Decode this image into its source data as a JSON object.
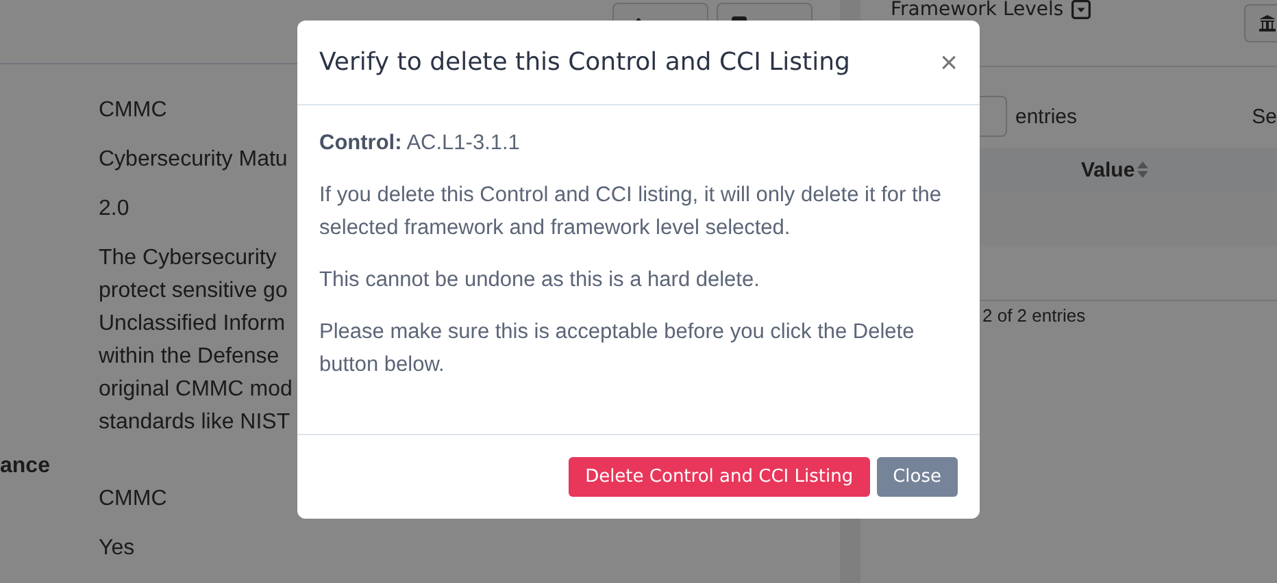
{
  "toolbar": {
    "buttons": [
      {
        "kind": "edit"
      },
      {
        "kind": "delete"
      }
    ]
  },
  "details": {
    "rows": [
      {
        "label": "",
        "values": [
          "CMMC"
        ]
      },
      {
        "label": "",
        "values": [
          "Cybersecurity Matu"
        ]
      },
      {
        "label": "",
        "values": [
          "2.0"
        ]
      },
      {
        "label": "",
        "values": [
          "The Cybersecurity",
          "protect sensitive go",
          "Unclassified Inform",
          "within the Defense",
          "original CMMC mod",
          "standards like NIST"
        ]
      },
      {
        "label": "ance",
        "values": []
      },
      {
        "label": "",
        "values": [
          "CMMC"
        ]
      },
      {
        "label": "",
        "values": [
          "Yes"
        ]
      }
    ]
  },
  "framework_levels": {
    "title": "Framework Levels",
    "entries_label": "entries",
    "search_label": "Se",
    "table": {
      "columns": [
        "Value"
      ]
    },
    "info": "2 of 2 entries"
  },
  "modal": {
    "title": "Verify to delete this Control and CCI Listing",
    "close_symbol": "×",
    "control_label": "Control:",
    "control_value": "AC.L1-3.1.1",
    "paragraphs": [
      "If you delete this Control and CCI listing, it will only delete it for the selected framework and framework level selected.",
      "This cannot be undone as this is a hard delete.",
      "Please make sure this is acceptable before you click the Delete button below."
    ],
    "buttons": [
      {
        "label": "Delete Control and CCI Listing",
        "kind": "danger"
      },
      {
        "label": "Close",
        "kind": "secondary"
      }
    ]
  }
}
